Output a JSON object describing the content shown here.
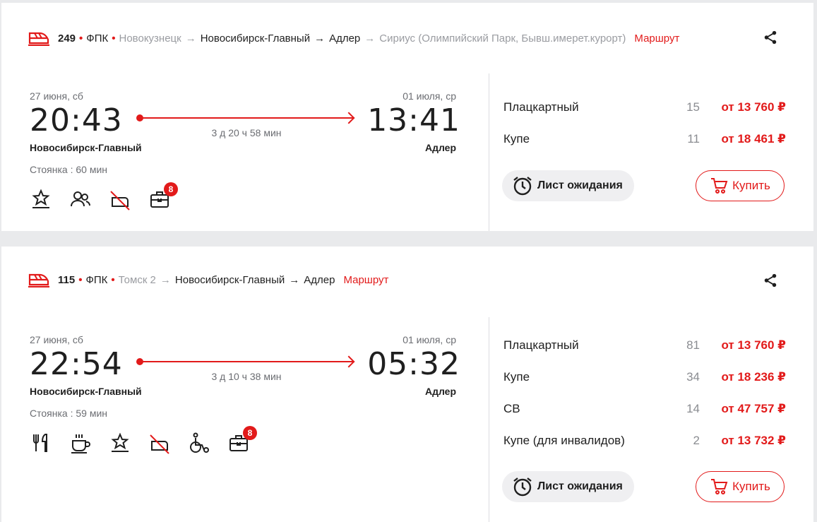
{
  "colors": {
    "accent": "#e21a1a",
    "muted": "#9a9ca1",
    "background": "#e9eaec"
  },
  "trains": [
    {
      "number": "249",
      "carrier": "ФПК",
      "route": [
        "Новокузнецк",
        "Новосибирск-Главный",
        "Адлер",
        "Сириус (Олимпийский Парк, Бывш.имерет.курорт)"
      ],
      "route_link": "Маршрут",
      "dep_date": "27 июня, сб",
      "dep_time": "20:43",
      "dep_station": "Новосибирск-Главный",
      "arr_date": "01 июля, ср",
      "arr_time": "13:41",
      "arr_station": "Адлер",
      "duration": "3 д 20 ч 58 мин",
      "stop": "Стоянка : 60 мин",
      "services": [
        "star-icon",
        "people-icon",
        "no-bed-linen-icon",
        "luggage-icon"
      ],
      "luggage_badge": "8",
      "classes": [
        {
          "name": "Плацкартный",
          "count": "15",
          "price": "от 13 760 ₽"
        },
        {
          "name": "Купе",
          "count": "11",
          "price": "от 18 461 ₽"
        }
      ],
      "wait_label": "Лист ожидания",
      "buy_label": "Купить"
    },
    {
      "number": "115",
      "carrier": "ФПК",
      "route": [
        "Томск 2",
        "Новосибирск-Главный",
        "Адлер"
      ],
      "route_link": "Маршрут",
      "dep_date": "27 июня, сб",
      "dep_time": "22:54",
      "dep_station": "Новосибирск-Главный",
      "arr_date": "01 июля, ср",
      "arr_time": "05:32",
      "arr_station": "Адлер",
      "duration": "3 д 10 ч 38 мин",
      "stop": "Стоянка : 59 мин",
      "services": [
        "restaurant-icon",
        "coffee-icon",
        "star-icon",
        "no-bed-linen-icon",
        "wheelchair-icon",
        "luggage-icon"
      ],
      "luggage_badge": "8",
      "classes": [
        {
          "name": "Плацкартный",
          "count": "81",
          "price": "от 13 760 ₽"
        },
        {
          "name": "Купе",
          "count": "34",
          "price": "от 18 236 ₽"
        },
        {
          "name": "СВ",
          "count": "14",
          "price": "от 47 757 ₽"
        },
        {
          "name": "Купе (для инвалидов)",
          "count": "2",
          "price": "от 13 732 ₽"
        }
      ],
      "wait_label": "Лист ожидания",
      "buy_label": "Купить"
    }
  ]
}
